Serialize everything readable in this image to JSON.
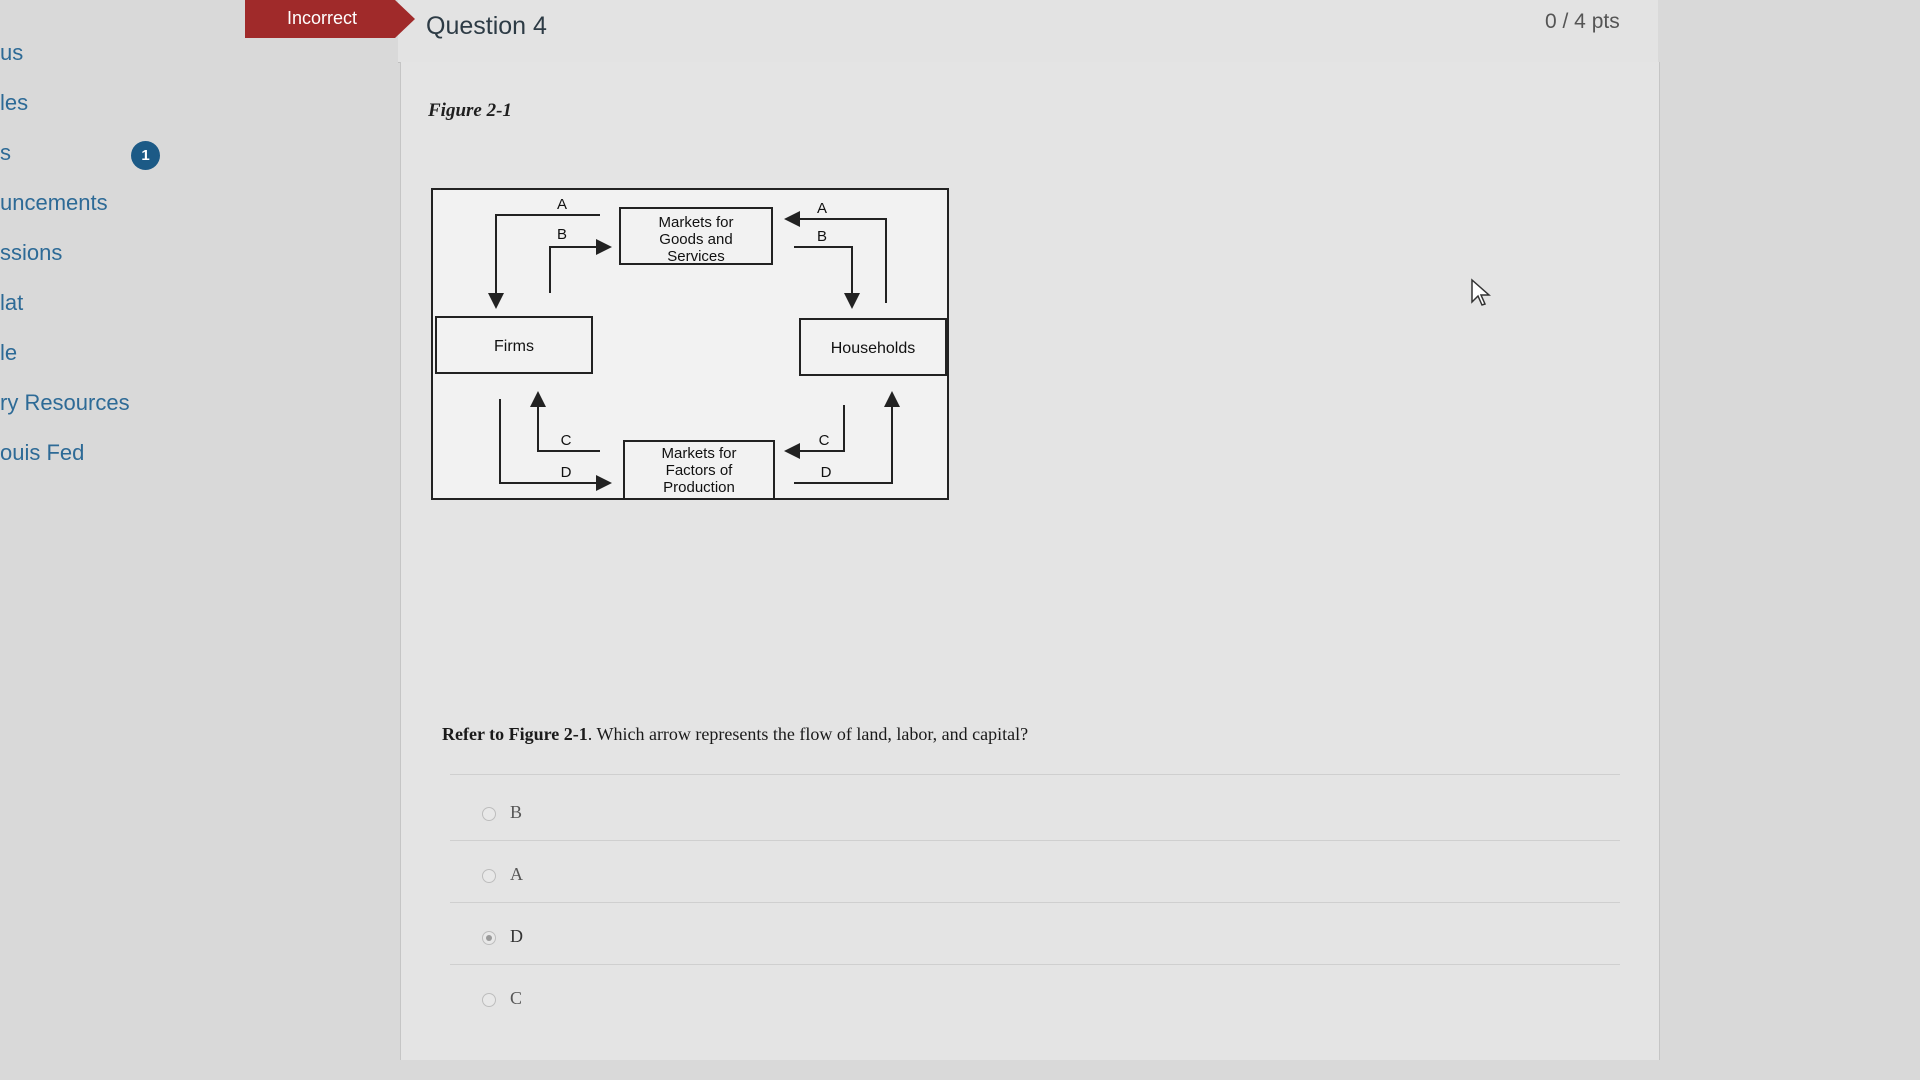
{
  "sidebar": {
    "items": [
      {
        "label": "us"
      },
      {
        "label": "les"
      },
      {
        "label": "s",
        "badge": "1"
      },
      {
        "label": "uncements"
      },
      {
        "label": "ssions"
      },
      {
        "label": "lat"
      },
      {
        "label": "le"
      },
      {
        "label": "ry Resources"
      },
      {
        "label": "ouis Fed"
      }
    ]
  },
  "question": {
    "status": "Incorrect",
    "title": "Question 4",
    "points": "0 / 4 pts",
    "figure_title": "Figure 2-1",
    "prompt_ref": "Refer to Figure 2-1",
    "prompt_text": ". Which arrow represents the flow of land, labor, and capital?",
    "answers": [
      {
        "label": "B",
        "selected": false
      },
      {
        "label": "A",
        "selected": false
      },
      {
        "label": "D",
        "selected": true
      },
      {
        "label": "C",
        "selected": false
      }
    ]
  },
  "diagram": {
    "goods_market": [
      "Markets for",
      "Goods and",
      "Services"
    ],
    "factor_market": [
      "Markets for",
      "Factors of",
      "Production"
    ],
    "firms": "Firms",
    "households": "Households",
    "arrow_labels": {
      "a": "A",
      "b": "B",
      "c": "C",
      "d": "D"
    }
  },
  "colors": {
    "incorrect_flag": "#a02a2a",
    "nav_link": "#2d6a96",
    "badge": "#1c5a86"
  }
}
